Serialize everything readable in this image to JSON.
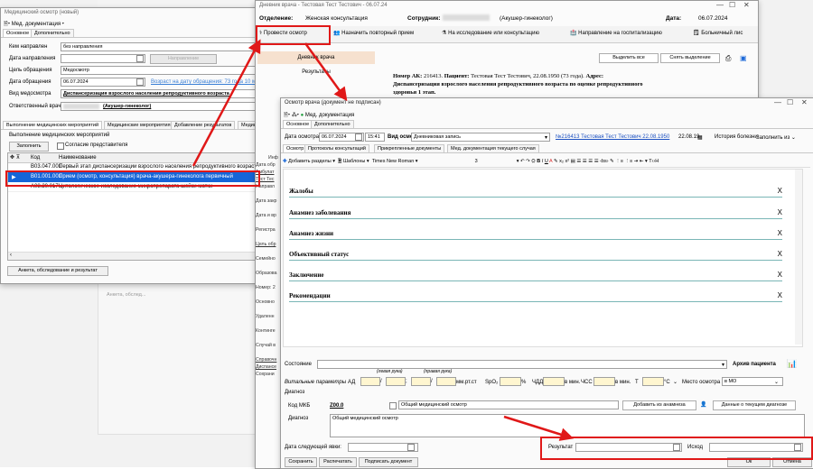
{
  "win1": {
    "title": "Медицинский осмотр (новый)",
    "doc_menu": "Мед. документация",
    "tabs": [
      "Основное",
      "Дополнительно"
    ],
    "fields": [
      {
        "label": "Кем направлен",
        "value": "без направления"
      },
      {
        "label": "Дата направления",
        "value": ""
      },
      {
        "label": "Цель обращения",
        "value": "Медосмотр"
      },
      {
        "label": "Дата обращения",
        "value": "06.07.2024"
      },
      {
        "label": "Вид медосмотра",
        "value": "Диспансеризация взрослого населения репродуктивного возраста"
      },
      {
        "label": "Ответственный врач",
        "value": "(Акушер-гинеколог)"
      }
    ],
    "napravlenie_btn": "Направление",
    "vozrast_link": "Возраст на дату обращения: 73 года 10 меся",
    "subtabs": [
      "Выполнение медицинских мероприятий",
      "Медицинские мероприятия",
      "Добавление результатов",
      "Медиц"
    ],
    "group_label": "Выполнение медицинских мероприятий",
    "fill_btn": "Заполнить",
    "consent_label": "Согласие представителя",
    "col_code": "Код",
    "col_name": "Наименование",
    "rows": [
      {
        "code": "В03.047.001",
        "name": "Первый этап диспансеризации взрослого населения репродуктивного возраст"
      },
      {
        "code": "В01.001.001",
        "name": "Прием (осмотр, консультация) врача-акушера-гинеколога первичный"
      },
      {
        "code": "А08.20.017",
        "name": "Цитологическое исследование микропрепарата шейки матки"
      }
    ],
    "anketa_btn": "Анкета, обследование и результат"
  },
  "win2": {
    "title": "Дневник врача - Тестовая Тест Тестович - 06.07.24",
    "otdelenie_label": "Отделение:",
    "otdelenie_value": "Женская консультация",
    "sotrudnik_label": "Сотрудник:",
    "sotrudnik_value": "(Акушер-гинеколог)",
    "data_label": "Дата:",
    "data_value": "06.07.2024",
    "toolbar": [
      "Провести осмотр",
      "Назначить повторный прием",
      "На исследование или консультацию",
      "Направление на госпитализацию",
      "Больничный лис"
    ],
    "left_tabs": [
      "Дневник врача",
      "Результаты"
    ],
    "select_all": "Выделить все",
    "deselect": "Снять выделение",
    "text_line1_a": "Номер АК:",
    "text_line1_b": " 216413. ",
    "text_line1_c": "Пациент:",
    "text_line1_d": " Тестовая Тест Тестович, 22.08.1950 (73 года). ",
    "text_line1_e": "Адрес:",
    "text_line2": "Диспансеризация взрослого населения репродуктивного возраста по оценке репродуктивного",
    "text_line3": "здоровья 1 этап.",
    "side_labels": [
      "Инф",
      "Дата обр",
      "Амбулат",
      "Тест Тес",
      "Направл",
      "Дата закр",
      "Дата и вр",
      "Регистра",
      "Цель обр",
      "Семейно",
      "Образова",
      "Номер: 2",
      "Основно",
      "Удаленн",
      "Континге",
      "Случай в",
      "Справочн",
      "Диспансе",
      "Сохрани"
    ]
  },
  "win3": {
    "title": "Осмотр врача (документ не подписан)",
    "doc_menu": "Мед. документация",
    "tabs": [
      "Основное",
      "Дополнительно"
    ],
    "date_label": "Дата осмотра",
    "date_value": "06.07.2024",
    "time_value": "15:41",
    "vid_label": "Вид осмотра",
    "vid_value": "Дневниковая запись",
    "patient_link": "№216413 Тестовая Тест Тестович 22.08.1950",
    "time_right": "22.08.19",
    "history_btn": "История болезни",
    "fill_from": "Заполнить из",
    "subtabs": [
      "Осмотр",
      "Протоколы консультаций",
      "Прикрепленные документы",
      "Мед. документация текущего случая"
    ],
    "add_sections": "Добавить разделы",
    "templates": "Шаблоны",
    "font_name": "Times New Roman",
    "font_size": "3",
    "sections": [
      "Жалобы",
      "Анамнез заболевания",
      "Анамнез жизни",
      "Объективный статус",
      "Заключение",
      "Рекомендации"
    ],
    "state_label": "Состояние",
    "archive_btn": "Архив пациента",
    "levaya": "(левая рука)",
    "pravaya": "(правая рука)",
    "vital_label": "Витальные параметры",
    "ad_label": "АД",
    "mmrtst": "мм.рт.ст",
    "spo2": "SpO₂",
    "pct": "%",
    "chdd": "ЧДД",
    "vmin1": "в мин.",
    "chss": "ЧСС",
    "vmin2": "в мин.",
    "t_label": "Т",
    "deg_c": "°С",
    "mesto_label": "Место осмотра",
    "mesto_value": "в МО",
    "diagnoz_hdr": "Диагноз",
    "mkb_label": "Код МКБ",
    "mkb_code": "Z00.0",
    "mkb_name": "Общий медицинский осмотр",
    "add_anamnez": "Добавить из анамнеза",
    "current_diag": "Данные о текущем диагнозе",
    "diag_label": "Диагноз",
    "diag_text": "Общий медицинский осмотр",
    "next_visit": "Дата следующей явки:",
    "result_label": "Результат",
    "ishod_label": "Исход",
    "save_btn": "Сохранить",
    "print_btn": "Распечатать",
    "sign_btn": "Подписать документ",
    "ok_btn": "Ок",
    "cancel_btn": "Отмена"
  },
  "bg_list_label": "Анкета, обследование и результат",
  "colors": {
    "red": "#e01818",
    "blue_sel": "#1565d8",
    "teal": "#7ab6b6"
  }
}
